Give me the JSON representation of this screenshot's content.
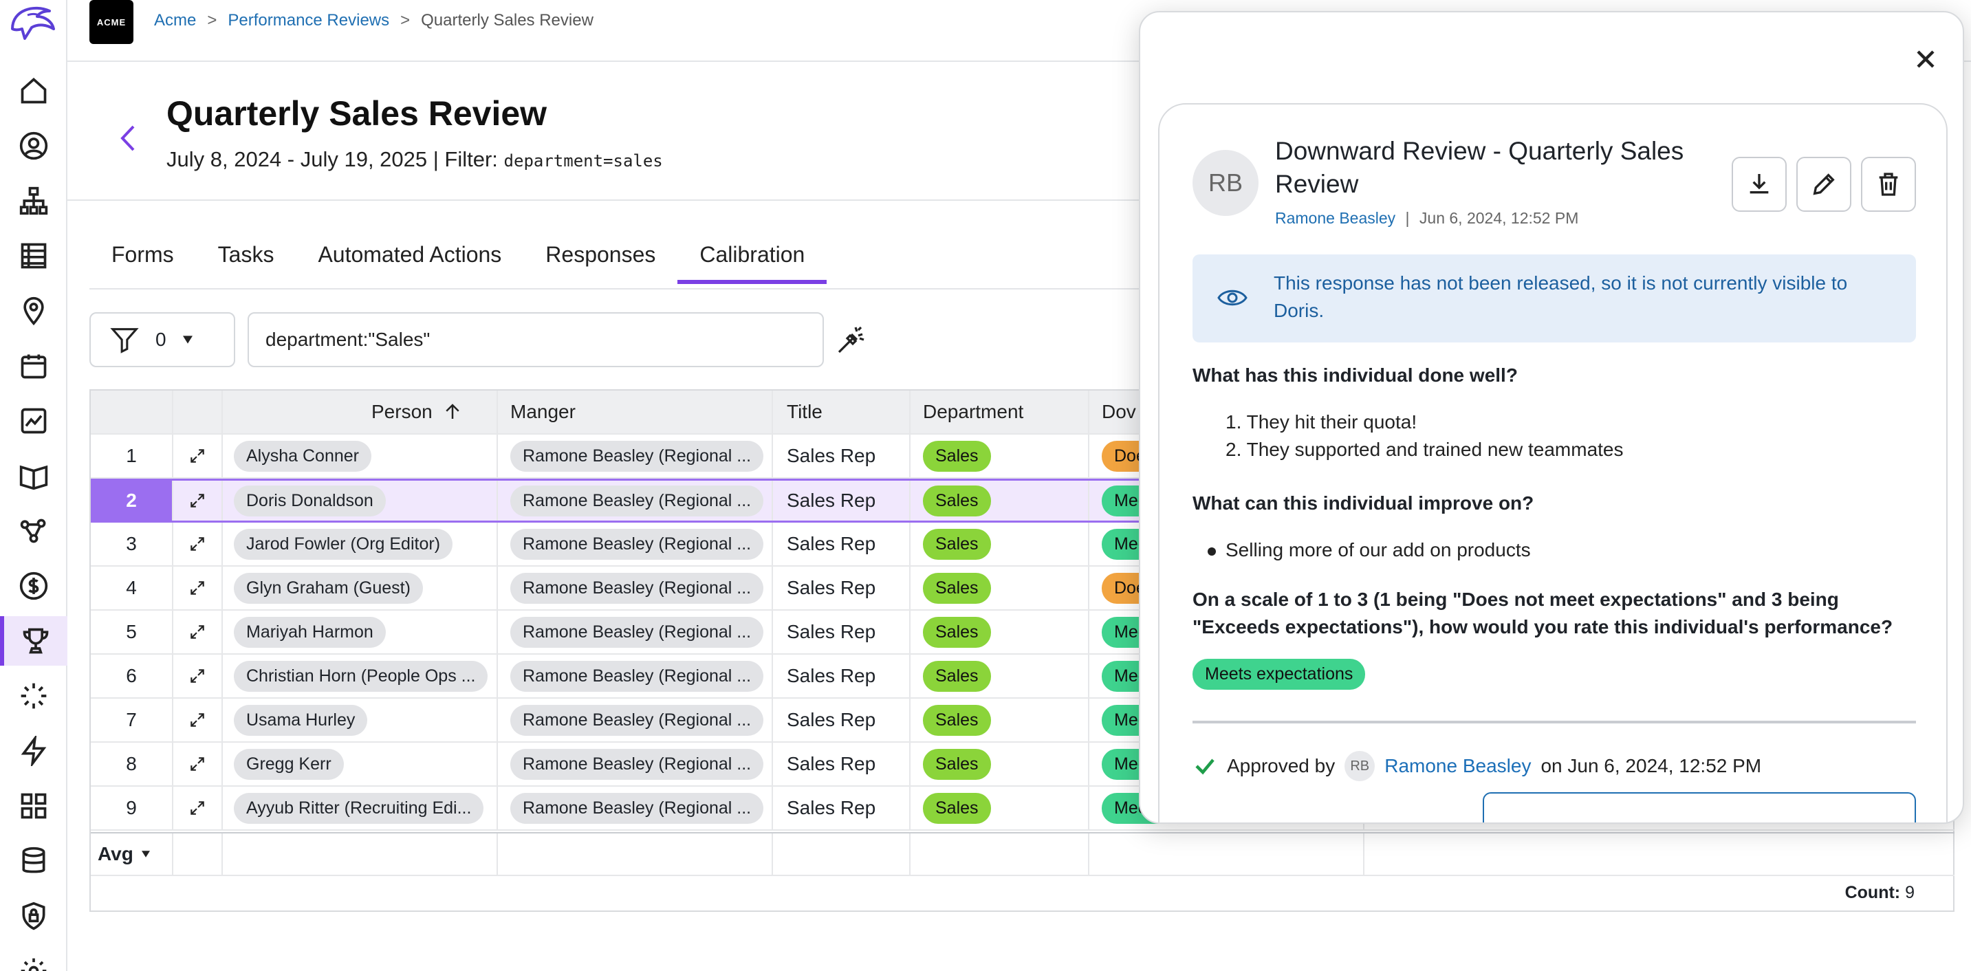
{
  "breadcrumb": {
    "root": "Acme",
    "section": "Performance Reviews",
    "current": "Quarterly Sales Review",
    "sep": ">"
  },
  "logo": {
    "text": "ACME"
  },
  "page": {
    "title": "Quarterly Sales Review",
    "dates": "July 8, 2024 - July 19, 2025 | Filter:",
    "filter_code": "department=sales"
  },
  "tabs": [
    "Forms",
    "Tasks",
    "Automated Actions",
    "Responses",
    "Calibration"
  ],
  "active_tab": "Calibration",
  "filter": {
    "count": "0",
    "query": "department:\"Sales\""
  },
  "table": {
    "headers": {
      "person": "Person",
      "manager": "Manger",
      "title": "Title",
      "department": "Department",
      "downward": "Dov"
    },
    "rows": [
      {
        "num": "1",
        "person": "Alysha Conner",
        "manager": "Ramone Beasley (Regional ...",
        "title": "Sales Rep",
        "dept": "Sales",
        "down": "Doe",
        "down_color": "orange"
      },
      {
        "num": "2",
        "person": "Doris Donaldson",
        "manager": "Ramone Beasley (Regional ...",
        "title": "Sales Rep",
        "dept": "Sales",
        "down": "Mee",
        "down_color": "mint"
      },
      {
        "num": "3",
        "person": "Jarod Fowler (Org Editor)",
        "manager": "Ramone Beasley (Regional ...",
        "title": "Sales Rep",
        "dept": "Sales",
        "down": "Mee",
        "down_color": "mint"
      },
      {
        "num": "4",
        "person": "Glyn Graham (Guest)",
        "manager": "Ramone Beasley (Regional ...",
        "title": "Sales Rep",
        "dept": "Sales",
        "down": "Doe",
        "down_color": "orange"
      },
      {
        "num": "5",
        "person": "Mariyah Harmon",
        "manager": "Ramone Beasley (Regional ...",
        "title": "Sales Rep",
        "dept": "Sales",
        "down": "Mee",
        "down_color": "mint"
      },
      {
        "num": "6",
        "person": "Christian Horn (People Ops ...",
        "manager": "Ramone Beasley (Regional ...",
        "title": "Sales Rep",
        "dept": "Sales",
        "down": "Mee",
        "down_color": "mint"
      },
      {
        "num": "7",
        "person": "Usama Hurley",
        "manager": "Ramone Beasley (Regional ...",
        "title": "Sales Rep",
        "dept": "Sales",
        "down": "Mee",
        "down_color": "mint"
      },
      {
        "num": "8",
        "person": "Gregg Kerr",
        "manager": "Ramone Beasley (Regional ...",
        "title": "Sales Rep",
        "dept": "Sales",
        "down": "Mee",
        "down_color": "mint"
      },
      {
        "num": "9",
        "person": "Ayyub Ritter (Recruiting Edi...",
        "manager": "Ramone Beasley (Regional ...",
        "title": "Sales Rep",
        "dept": "Sales",
        "down": "Meets expectations",
        "down_color": "mint"
      }
    ],
    "selected_row": 1,
    "avg_label": "Avg",
    "count_label": "Count:",
    "count_value": "9"
  },
  "modal": {
    "avatar": "RB",
    "title": "Downward Review - Quarterly Sales Review",
    "author": "Ramone Beasley",
    "meta_sep": "|",
    "timestamp": "Jun 6, 2024, 12:52 PM",
    "notice": "This response has not been released, so it is not currently visible to Doris.",
    "q1": "What has this individual done well?",
    "q1_answers": [
      "They hit their quota!",
      "They supported and trained new teammates"
    ],
    "q2": "What can this individual improve on?",
    "q2_answers": [
      "Selling more of our add on products"
    ],
    "q3": "On a scale of 1 to 3 (1 being \"Does not meet expectations\" and 3 being \"Exceeds expectations\"), how would you rate this individual's performance?",
    "rating": "Meets expectations",
    "approved_prefix": "Approved by",
    "approved_avatar": "RB",
    "approved_name": "Ramone Beasley",
    "approved_suffix": "on Jun 6, 2024, 12:52 PM"
  },
  "colors": {
    "accent": "#7a3fe4",
    "link": "#1f6fb2",
    "green": "#8bd43a",
    "mint": "#3fd38e",
    "orange": "#f2a440",
    "notice_bg": "#e5eef9"
  }
}
